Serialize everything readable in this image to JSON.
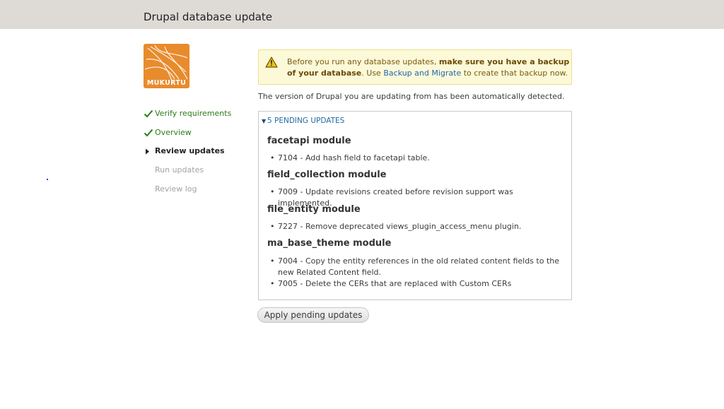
{
  "header": {
    "title": "Drupal database update"
  },
  "logo": {
    "text": "MUKURTU"
  },
  "tasks": [
    {
      "label": "Verify requirements",
      "status": "done"
    },
    {
      "label": "Overview",
      "status": "done"
    },
    {
      "label": "Review updates",
      "status": "active"
    },
    {
      "label": "Run updates",
      "status": "todo"
    },
    {
      "label": "Review log",
      "status": "todo"
    }
  ],
  "warning": {
    "prefix": "Before you run any database updates, ",
    "bold": "make sure you have a backup of your database",
    "middle": ". Use ",
    "link": "Backup and Migrate",
    "suffix": " to create that backup now."
  },
  "intro": "The version of Drupal you are updating from has been automatically detected.",
  "pending": {
    "legend": "5 PENDING UPDATES",
    "modules": [
      {
        "name": "facetapi module",
        "updates": [
          "7104 - Add hash field to facetapi table."
        ]
      },
      {
        "name": "field_collection module",
        "updates": [
          "7009 - Update revisions created before revision support was implemented."
        ]
      },
      {
        "name": "file_entity module",
        "updates": [
          "7227 - Remove deprecated views_plugin_access_menu plugin."
        ]
      },
      {
        "name": "ma_base_theme module",
        "updates": [
          "7004 - Copy the entity references in the old related content fields to the new Related Content field.",
          "7005 - Delete the CERs that are replaced with Custom CERs"
        ]
      }
    ]
  },
  "apply_button": "Apply pending updates",
  "colors": {
    "header_bg": "#dedbd6",
    "logo_orange": "#e88b2d",
    "done_green": "#2c7b16",
    "link_blue": "#2266aa",
    "warning_bg": "#fcf9d9"
  }
}
